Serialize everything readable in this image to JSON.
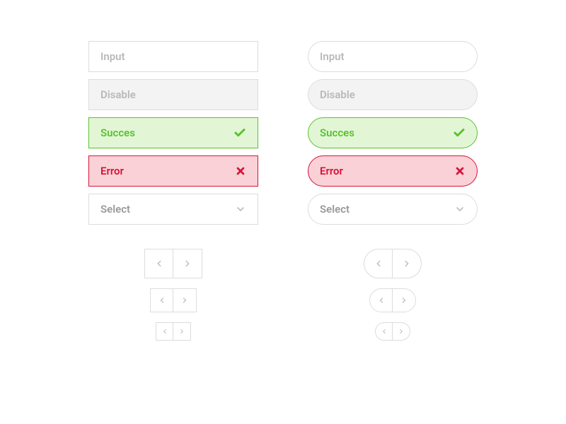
{
  "fields": {
    "input": "Input",
    "disable": "Disable",
    "success": "Succes",
    "error": "Error",
    "select": "Select"
  },
  "colors": {
    "border_default": "#dcdcdc",
    "disabled_bg": "#f3f3f3",
    "success_border": "#59c22d",
    "success_bg": "#e2f6d6",
    "error_border": "#d6133a",
    "error_bg": "#f9d1d6"
  },
  "icons": {
    "check": "check-icon",
    "cross": "x-icon",
    "chevron_down": "chevron-down-icon",
    "chevron_left": "chevron-left-icon",
    "chevron_right": "chevron-right-icon"
  }
}
